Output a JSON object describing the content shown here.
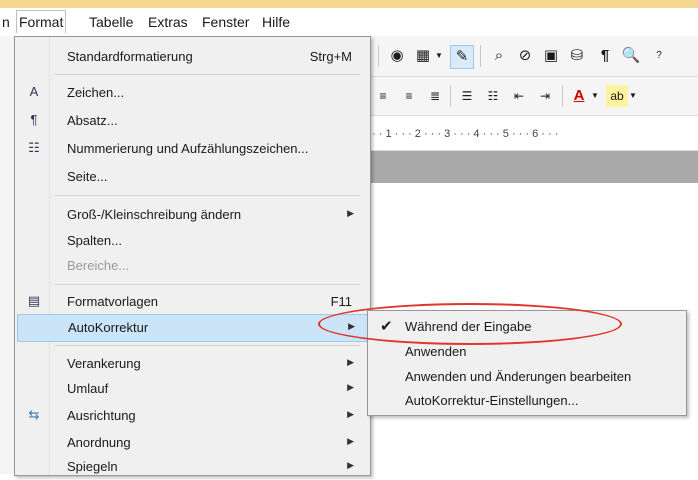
{
  "menubar": {
    "items": [
      {
        "label": "n",
        "x": 0
      },
      {
        "label": "Format",
        "active": true
      },
      {
        "label": "Tabelle"
      },
      {
        "label": "Extras"
      },
      {
        "label": "Fenster"
      },
      {
        "label": "Hilfe"
      }
    ]
  },
  "ruler": {
    "text": "· · 1 · · · 2 · · · 3 · · · 4 · · · 5 · · · 6 · · ·"
  },
  "format_menu": {
    "items": [
      {
        "label": "Standardformatierung",
        "shortcut": "Strg+M"
      },
      {
        "label": "Zeichen...",
        "icon": "character-icon"
      },
      {
        "label": "Absatz...",
        "icon": "paragraph-icon"
      },
      {
        "label": "Nummerierung und Aufzählungszeichen...",
        "icon": "numbering-icon"
      },
      {
        "label": "Seite..."
      },
      {
        "label": "Groß-/Kleinschreibung ändern",
        "submenu": true
      },
      {
        "label": "Spalten..."
      },
      {
        "label": "Bereiche...",
        "disabled": true
      },
      {
        "label": "Formatvorlagen",
        "shortcut": "F11",
        "icon": "styles-icon"
      },
      {
        "label": "AutoKorrektur",
        "submenu": true,
        "highlighted": true
      },
      {
        "label": "Verankerung",
        "submenu": true
      },
      {
        "label": "Umlauf",
        "submenu": true
      },
      {
        "label": "Ausrichtung",
        "submenu": true,
        "icon": "align-icon"
      },
      {
        "label": "Anordnung",
        "submenu": true
      },
      {
        "label": "Spiegeln",
        "submenu": true
      }
    ]
  },
  "autokorrektur_submenu": {
    "items": [
      {
        "label": "Während der Eingabe",
        "checked": true
      },
      {
        "label": "Anwenden"
      },
      {
        "label": "Anwenden und Änderungen bearbeiten"
      },
      {
        "label": "AutoKorrektur-Einstellungen..."
      }
    ]
  },
  "colors": {
    "highlight": "#cce4f7",
    "annotation": "#e0362b",
    "accent_bar": "#f3d78e"
  }
}
